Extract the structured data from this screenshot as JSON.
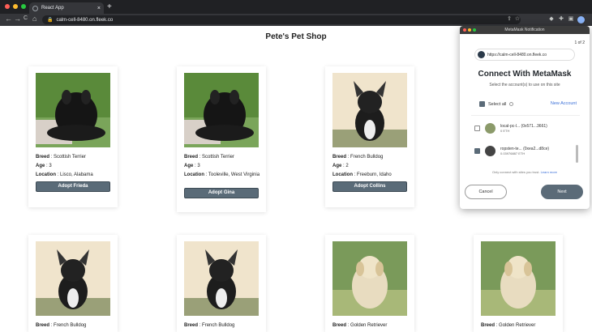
{
  "browser": {
    "tab_title": "React App",
    "tab_close": "×",
    "new_tab": "+",
    "url": "calm-cell-8480.on.fleek.co",
    "back": "←",
    "forward": "→",
    "reload": "C",
    "home": "⌂",
    "lock_icon": "🔒",
    "icons": [
      "share-icon",
      "star-icon",
      "extension-icon",
      "puzzle-icon",
      "menu-icon"
    ]
  },
  "shop": {
    "title": "Pete's Pet Shop",
    "breed_label": "Breed",
    "age_label": "Age",
    "location_label": "Location",
    "pets": [
      {
        "breed": "Scottish Terrier",
        "age": "3",
        "location": "Lisco, Alabama",
        "button": "Adopt Frieda",
        "photo": "scottish-terrier"
      },
      {
        "breed": "Scottish Terrier",
        "age": "3",
        "location": "Tooleville, West Virginia",
        "button": "Adopt Gina",
        "photo": "scottish-terrier"
      },
      {
        "breed": "French Bulldog",
        "age": "2",
        "location": "Freeburn, Idaho",
        "button": "Adopt Collins",
        "photo": "french-bulldog"
      },
      {
        "breed": "French Bulldog",
        "photo": "french-bulldog"
      },
      {
        "breed": "French Bulldog",
        "photo": "french-bulldog"
      },
      {
        "breed": "Golden Retriever",
        "photo": "golden-retriever"
      },
      {
        "breed": "Golden Retriever",
        "photo": "golden-retriever"
      }
    ]
  },
  "metamask": {
    "window_title": "MetaMask Notification",
    "pager": "1 of 2",
    "site_url": "https://calm-cell-8480.on.fleek.co",
    "heading": "Connect With MetaMask",
    "subheading": "Select the account(s) to use on this site",
    "select_all": "Select all",
    "new_account": "New Account",
    "accounts": [
      {
        "name": "local-pc-l... (0x571...3661)",
        "balance": "0 ETH",
        "checked": false
      },
      {
        "name": "ropsten-te... (0xea2...d8ce)",
        "balance": "0.03976887 ETH",
        "checked": true
      }
    ],
    "note": "Only connect with sites you trust.",
    "learn_more": "Learn more",
    "cancel": "Cancel",
    "next": "Next"
  }
}
